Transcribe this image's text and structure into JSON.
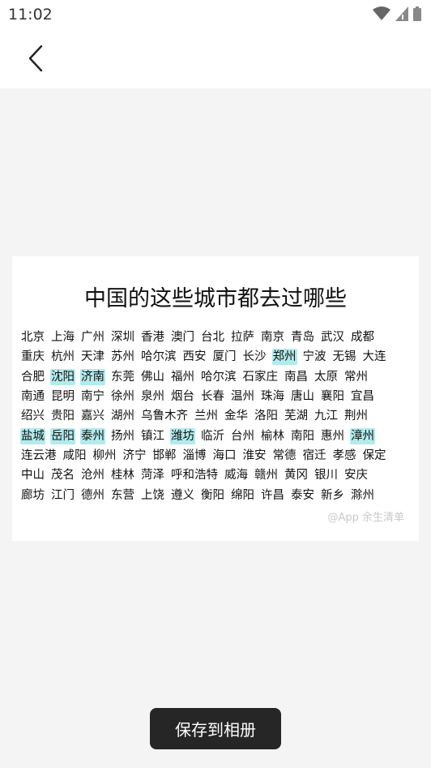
{
  "status_bar": {
    "time": "11:02",
    "icons": [
      "wifi-icon",
      "signal-icon",
      "battery-icon"
    ]
  },
  "app_bar": {
    "back_icon": "chevron-left-icon"
  },
  "card": {
    "title": "中国的这些城市都去过哪些",
    "rows": [
      [
        {
          "name": "北京"
        },
        {
          "name": "上海"
        },
        {
          "name": "广州"
        },
        {
          "name": "深圳"
        },
        {
          "name": "香港"
        },
        {
          "name": "澳门"
        },
        {
          "name": "台北"
        },
        {
          "name": "拉萨"
        },
        {
          "name": "南京"
        },
        {
          "name": "青岛"
        },
        {
          "name": "武汉"
        },
        {
          "name": "成都"
        }
      ],
      [
        {
          "name": "重庆"
        },
        {
          "name": "杭州"
        },
        {
          "name": "天津"
        },
        {
          "name": "苏州"
        },
        {
          "name": "哈尔滨"
        },
        {
          "name": "西安"
        },
        {
          "name": "厦门"
        },
        {
          "name": "长沙"
        },
        {
          "name": "郑州",
          "highlighted": true
        },
        {
          "name": "宁波"
        },
        {
          "name": "无锡"
        },
        {
          "name": "大连"
        }
      ],
      [
        {
          "name": "合肥"
        },
        {
          "name": "沈阳",
          "highlighted": true
        },
        {
          "name": "济南",
          "highlighted": true
        },
        {
          "name": "东莞"
        },
        {
          "name": "佛山"
        },
        {
          "name": "福州"
        },
        {
          "name": "哈尔滨"
        },
        {
          "name": "石家庄"
        },
        {
          "name": "南昌"
        },
        {
          "name": "太原"
        },
        {
          "name": "常州"
        }
      ],
      [
        {
          "name": "南通"
        },
        {
          "name": "昆明"
        },
        {
          "name": "南宁"
        },
        {
          "name": "徐州"
        },
        {
          "name": "泉州"
        },
        {
          "name": "烟台"
        },
        {
          "name": "长春"
        },
        {
          "name": "温州"
        },
        {
          "name": "珠海"
        },
        {
          "name": "唐山"
        },
        {
          "name": "襄阳"
        },
        {
          "name": "宜昌"
        }
      ],
      [
        {
          "name": "绍兴"
        },
        {
          "name": "贵阳"
        },
        {
          "name": "嘉兴"
        },
        {
          "name": "湖州"
        },
        {
          "name": "乌鲁木齐"
        },
        {
          "name": "兰州"
        },
        {
          "name": "金华"
        },
        {
          "name": "洛阳"
        },
        {
          "name": "芜湖"
        },
        {
          "name": "九江"
        },
        {
          "name": "荆州"
        }
      ],
      [
        {
          "name": "盐城",
          "highlighted": true
        },
        {
          "name": "岳阳",
          "highlighted": true
        },
        {
          "name": "泰州",
          "highlighted": true
        },
        {
          "name": "扬州"
        },
        {
          "name": "镇江"
        },
        {
          "name": "潍坊",
          "highlighted": true
        },
        {
          "name": "临沂"
        },
        {
          "name": "台州"
        },
        {
          "name": "榆林"
        },
        {
          "name": "南阳"
        },
        {
          "name": "惠州"
        },
        {
          "name": "漳州",
          "highlighted": true
        }
      ],
      [
        {
          "name": "连云港"
        },
        {
          "name": "咸阳"
        },
        {
          "name": "柳州"
        },
        {
          "name": "济宁"
        },
        {
          "name": "邯郸"
        },
        {
          "name": "淄博"
        },
        {
          "name": "海口"
        },
        {
          "name": "淮安"
        },
        {
          "name": "常德"
        },
        {
          "name": "宿迁"
        },
        {
          "name": "孝感"
        },
        {
          "name": "保定"
        }
      ],
      [
        {
          "name": "中山"
        },
        {
          "name": "茂名"
        },
        {
          "name": "沧州"
        },
        {
          "name": "桂林"
        },
        {
          "name": "菏泽"
        },
        {
          "name": "呼和浩特"
        },
        {
          "name": "威海"
        },
        {
          "name": "赣州"
        },
        {
          "name": "黄冈"
        },
        {
          "name": "银川"
        },
        {
          "name": "安庆"
        }
      ],
      [
        {
          "name": "廊坊"
        },
        {
          "name": "江门"
        },
        {
          "name": "德州"
        },
        {
          "name": "东营"
        },
        {
          "name": "上饶"
        },
        {
          "name": "遵义"
        },
        {
          "name": "衡阳"
        },
        {
          "name": "绵阳"
        },
        {
          "name": "许昌"
        },
        {
          "name": "泰安"
        },
        {
          "name": "新乡"
        },
        {
          "name": "滁州"
        }
      ]
    ],
    "watermark": "@App 余生清单",
    "highlight_color": "#b2ebee"
  },
  "save_button": {
    "label": "保存到相册"
  }
}
